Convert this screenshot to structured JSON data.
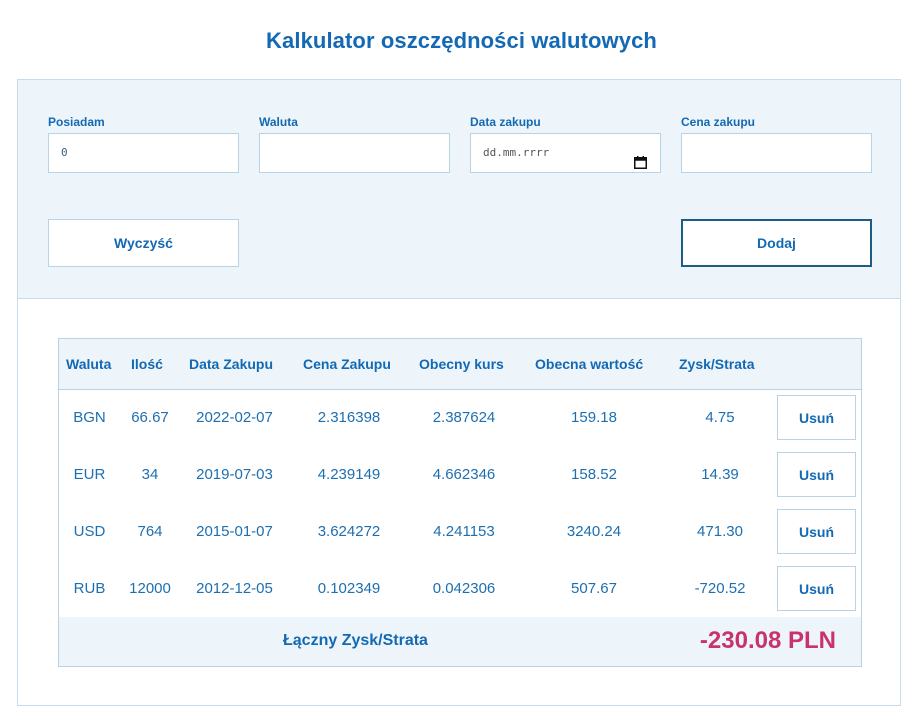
{
  "title": "Kalkulator oszczędności walutowych",
  "form": {
    "fields": [
      {
        "label": "Posiadam",
        "value": "0",
        "placeholder": ""
      },
      {
        "label": "Waluta",
        "value": "",
        "placeholder": ""
      },
      {
        "label": "Data zakupu",
        "value": "",
        "placeholder": "dd.mm.rrrr"
      },
      {
        "label": "Cena zakupu",
        "value": "",
        "placeholder": ""
      }
    ],
    "clear_label": "Wyczyść",
    "add_label": "Dodaj"
  },
  "table": {
    "headers": [
      "Waluta",
      "Ilość",
      "Data Zakupu",
      "Cena Zakupu",
      "Obecny kurs",
      "Obecna wartość",
      "Zysk/Strata"
    ],
    "rows": [
      {
        "currency": "BGN",
        "amount": "66.67",
        "date": "2022-02-07",
        "price": "2.316398",
        "rate": "2.387624",
        "value": "159.18",
        "profit": "4.75",
        "remove_label": "Usuń"
      },
      {
        "currency": "EUR",
        "amount": "34",
        "date": "2019-07-03",
        "price": "4.239149",
        "rate": "4.662346",
        "value": "158.52",
        "profit": "14.39",
        "remove_label": "Usuń"
      },
      {
        "currency": "USD",
        "amount": "764",
        "date": "2015-01-07",
        "price": "3.624272",
        "rate": "4.241153",
        "value": "3240.24",
        "profit": "471.30",
        "remove_label": "Usuń"
      },
      {
        "currency": "RUB",
        "amount": "12000",
        "date": "2012-12-05",
        "price": "0.102349",
        "rate": "0.042306",
        "value": "507.67",
        "profit": "-720.52",
        "remove_label": "Usuń"
      }
    ],
    "total_label": "Łączny Zysk/Strata",
    "total_value": "-230.08 PLN"
  },
  "colors": {
    "accent": "#1369b3",
    "panel_bg": "#eef5fa",
    "border": "#b9d3e6",
    "total_negative": "#c9336d"
  },
  "icons": {
    "date_picker": "calendar-icon"
  }
}
